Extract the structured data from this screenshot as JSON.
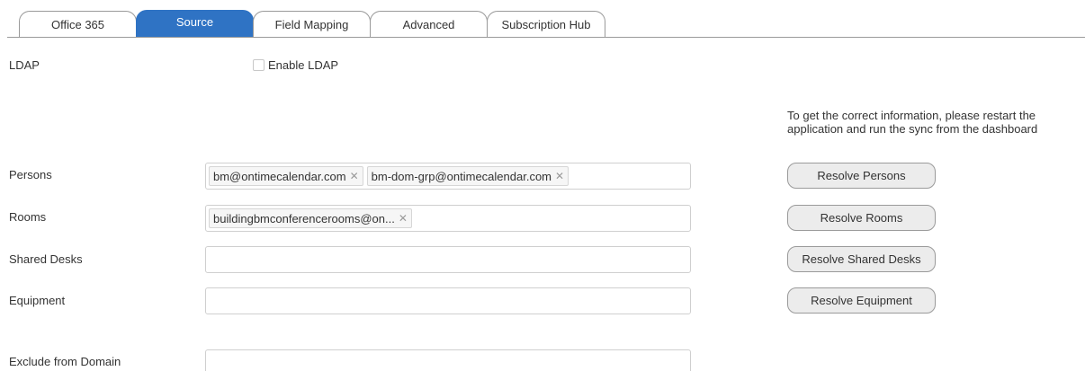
{
  "tabs": [
    {
      "label": "Office 365",
      "active": false
    },
    {
      "label": "Source",
      "active": true
    },
    {
      "label": "Field Mapping",
      "active": false
    },
    {
      "label": "Advanced",
      "active": false
    },
    {
      "label": "Subscription Hub",
      "active": false
    }
  ],
  "ldap": {
    "label": "LDAP",
    "checkbox_label": "Enable LDAP",
    "checked": false
  },
  "note": "To get the correct information, please restart the application and run the sync from the dashboard",
  "persons": {
    "label": "Persons",
    "tags": [
      "bm@ontimecalendar.com",
      "bm-dom-grp@ontimecalendar.com"
    ],
    "button": "Resolve Persons"
  },
  "rooms": {
    "label": "Rooms",
    "tags": [
      "buildingbmconferencerooms@on..."
    ],
    "button": "Resolve Rooms"
  },
  "shared_desks": {
    "label": "Shared Desks",
    "button": "Resolve Shared Desks"
  },
  "equipment": {
    "label": "Equipment",
    "button": "Resolve Equipment"
  },
  "exclude": {
    "label": "Exclude from Domain"
  },
  "colors": {
    "accent": "#2f73c4",
    "button_bg": "#ececec",
    "border": "#9a9a9a"
  },
  "icons": {
    "remove_tag": "close-icon"
  }
}
